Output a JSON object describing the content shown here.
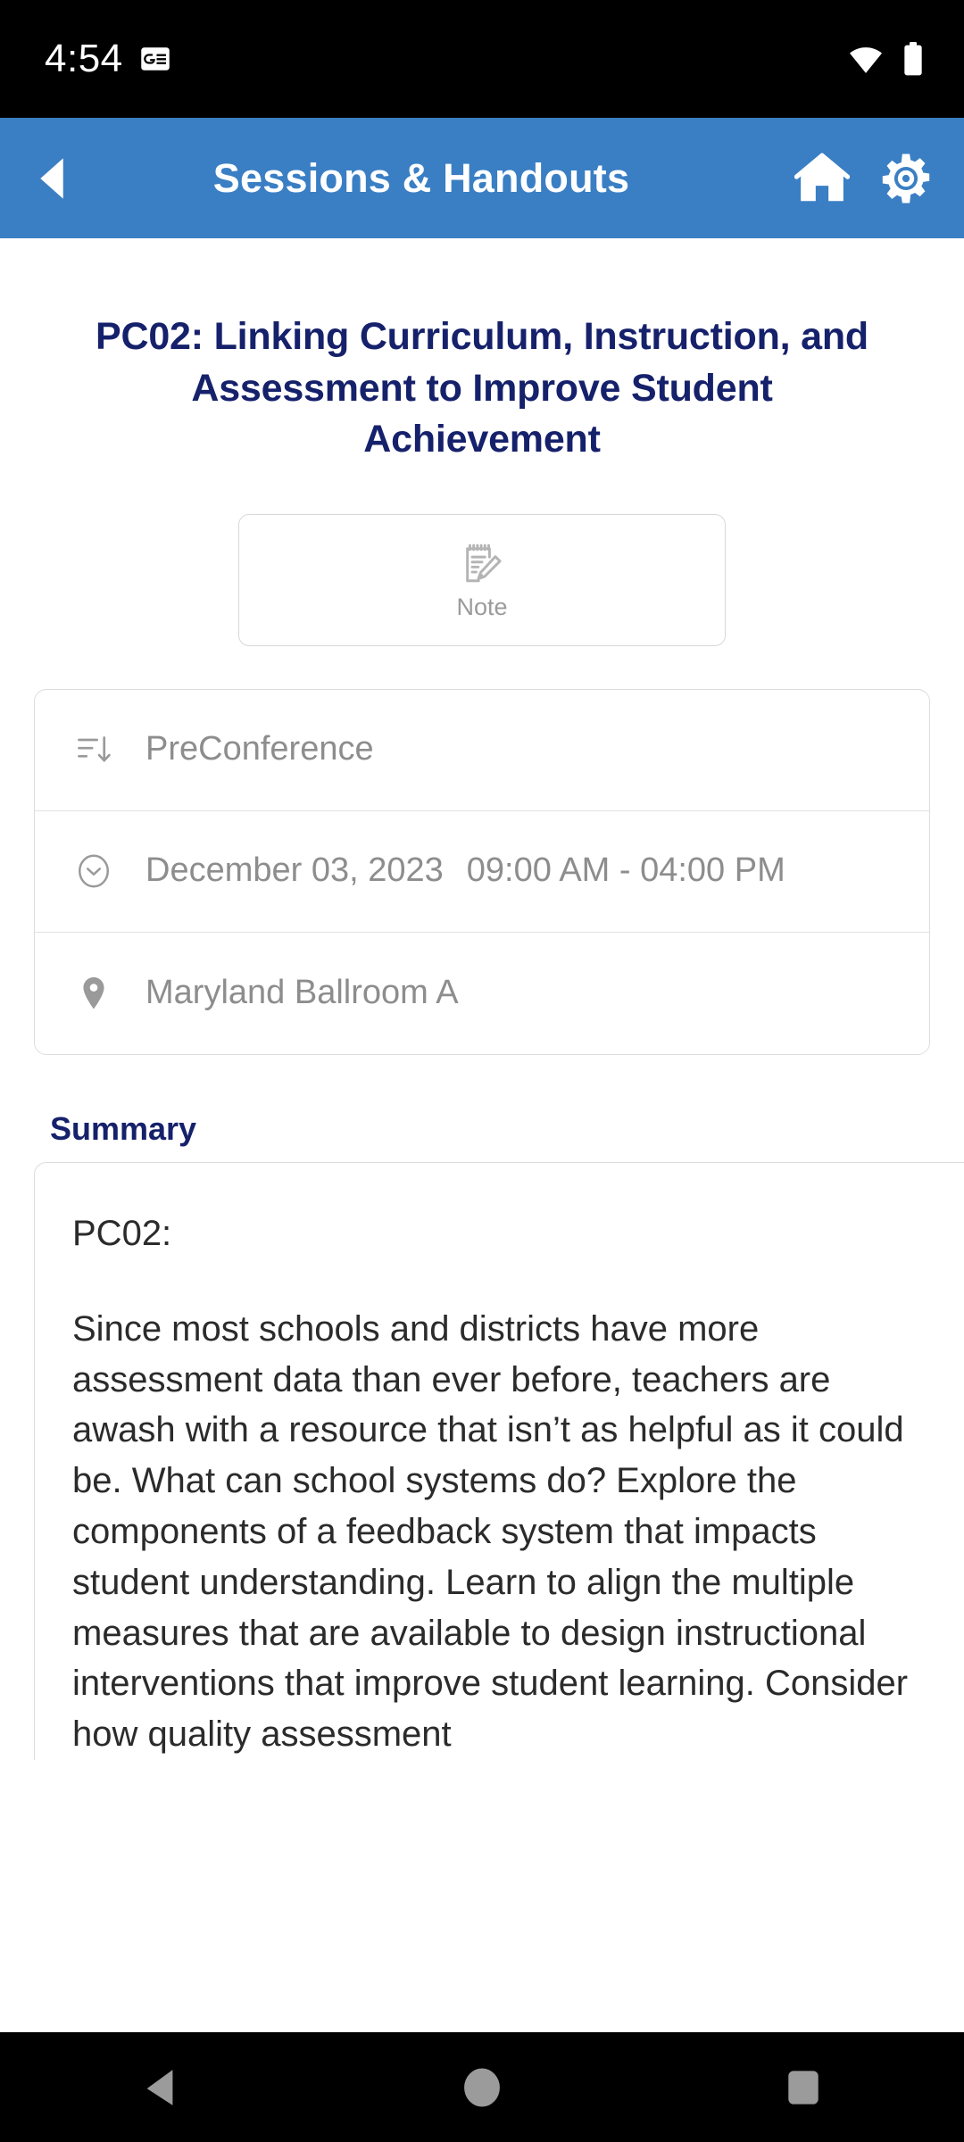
{
  "status_bar": {
    "time": "4:54",
    "news_icon": "google-news-icon",
    "wifi_icon": "wifi-icon",
    "battery_icon": "battery-full-icon"
  },
  "app_bar": {
    "back_icon": "back-arrow-icon",
    "title": "Sessions & Handouts",
    "home_icon": "home-icon",
    "settings_icon": "gear-icon",
    "background_color": "#3a7fc4",
    "title_color": "#ffffff"
  },
  "session": {
    "title": "PC02: Linking Curriculum, Instruction, and Assessment to Improve Student Achievement",
    "title_color": "#16216b"
  },
  "note_button": {
    "label": "Note",
    "icon": "note-edit-icon"
  },
  "info_rows": [
    {
      "icon": "sort-descending-icon",
      "text": "PreConference"
    },
    {
      "icon": "clock-icon",
      "date": "December 03, 2023",
      "time": "09:00 AM - 04:00 PM"
    },
    {
      "icon": "map-pin-icon",
      "text": "Maryland Ballroom A"
    }
  ],
  "summary": {
    "heading": "Summary",
    "heading_color": "#16216b",
    "code": "PC02:",
    "body": "Since most schools and districts have more assessment data than ever before, teachers are awash with a resource that isn’t as helpful as it could be. What can school systems do? Explore the components of a feedback system that impacts student understanding. Learn to align the multiple measures that are available to design instructional interventions that improve student learning. Consider how quality assessment"
  },
  "nav_bar": {
    "back_icon": "nav-back-icon",
    "home_icon": "nav-home-icon",
    "recents_icon": "nav-recents-icon"
  }
}
